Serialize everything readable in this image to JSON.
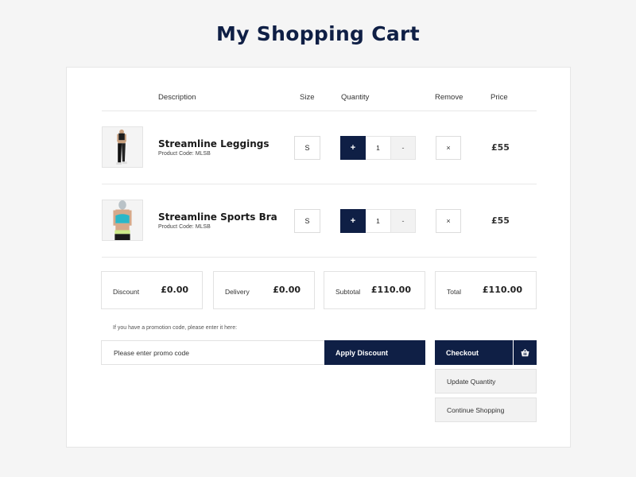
{
  "page": {
    "title": "My Shopping Cart"
  },
  "table": {
    "headers": {
      "description": "Description",
      "size": "Size",
      "quantity": "Quantity",
      "remove": "Remove",
      "price": "Price"
    }
  },
  "items": [
    {
      "name": "Streamline Leggings",
      "code": "Product Code: MLSB",
      "size": "S",
      "plus": "+",
      "qty": "1",
      "minus": "-",
      "remove": "×",
      "price": "£55"
    },
    {
      "name": "Streamline Sports Bra",
      "code": "Product Code: MLSB",
      "size": "S",
      "plus": "+",
      "qty": "1",
      "minus": "-",
      "remove": "×",
      "price": "£55"
    }
  ],
  "summary": {
    "discount": {
      "label": "Discount",
      "value": "£0.00"
    },
    "delivery": {
      "label": "Delivery",
      "value": "£0.00"
    },
    "subtotal": {
      "label": "Subtotal",
      "value": "£110.00"
    },
    "total": {
      "label": "Total",
      "value": "£110.00"
    }
  },
  "promo": {
    "hint": "If you have a promotion code, please enter it here:",
    "placeholder": "Please enter promo code",
    "apply_label": "Apply Discount"
  },
  "actions": {
    "checkout_label": "Checkout",
    "checkout_icon": "basket-icon",
    "update_label": "Update Quantity",
    "continue_label": "Continue Shopping"
  },
  "colors": {
    "accent": "#0f1f45",
    "background": "#f5f5f5"
  }
}
